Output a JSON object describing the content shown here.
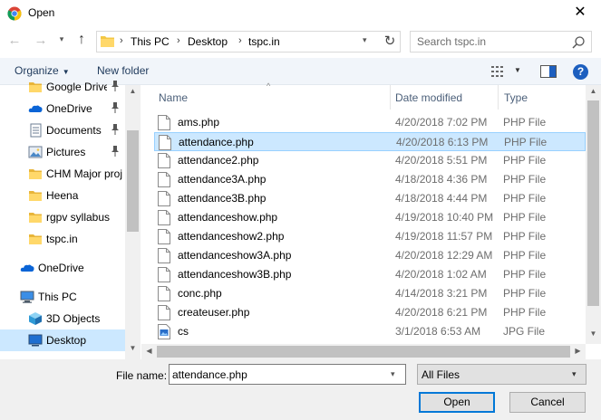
{
  "window": {
    "title": "Open",
    "close_glyph": "✕",
    "icon": "chrome-icon"
  },
  "navigation": {
    "back_glyph": "←",
    "forward_glyph": "→",
    "recent_glyph": "▾",
    "up_glyph": "↑",
    "breadcrumbs": [
      "This PC",
      "Desktop",
      "tspc.in"
    ],
    "separator": "›",
    "refresh_glyph": "↻",
    "search_placeholder": "Search tspc.in"
  },
  "toolbar": {
    "organize_label": "Organize",
    "organize_arrow": "▼",
    "new_folder_label": "New folder",
    "view_dropdown_glyph": "▼",
    "help_label": "?"
  },
  "sidebar": {
    "items": [
      {
        "label": "Google Drive",
        "icon": "folder-icon",
        "pinned": true
      },
      {
        "label": "OneDrive",
        "icon": "onedrive-icon",
        "pinned": true
      },
      {
        "label": "Documents",
        "icon": "documents-icon",
        "pinned": true
      },
      {
        "label": "Pictures",
        "icon": "pictures-icon",
        "pinned": true
      },
      {
        "label": "CHM Major proj",
        "icon": "folder-icon",
        "pinned": false
      },
      {
        "label": "Heena",
        "icon": "folder-icon",
        "pinned": false
      },
      {
        "label": "rgpv syllabus",
        "icon": "folder-icon",
        "pinned": false
      },
      {
        "label": "tspc.in",
        "icon": "folder-icon",
        "pinned": false
      },
      {
        "label": "OneDrive",
        "icon": "onedrive-icon",
        "pinned": false
      },
      {
        "label": "This PC",
        "icon": "computer-icon",
        "pinned": false
      },
      {
        "label": "3D Objects",
        "icon": "3d-objects-icon",
        "pinned": false
      },
      {
        "label": "Desktop",
        "icon": "desktop-icon",
        "pinned": false
      }
    ],
    "pin_glyph": "📌",
    "selected_item": "Desktop"
  },
  "file_list": {
    "columns": [
      "Name",
      "Date modified",
      "Type"
    ],
    "sort_glyph": "^",
    "rows": [
      {
        "name": "ams.php",
        "date": "4/20/2018 7:02 PM",
        "type": "PHP File"
      },
      {
        "name": "attendance.php",
        "date": "4/20/2018 6:13 PM",
        "type": "PHP File"
      },
      {
        "name": "attendance2.php",
        "date": "4/20/2018 5:51 PM",
        "type": "PHP File"
      },
      {
        "name": "attendance3A.php",
        "date": "4/18/2018 4:36 PM",
        "type": "PHP File"
      },
      {
        "name": "attendance3B.php",
        "date": "4/18/2018 4:44 PM",
        "type": "PHP File"
      },
      {
        "name": "attendanceshow.php",
        "date": "4/19/2018 10:40 PM",
        "type": "PHP File"
      },
      {
        "name": "attendanceshow2.php",
        "date": "4/19/2018 11:57 PM",
        "type": "PHP File"
      },
      {
        "name": "attendanceshow3A.php",
        "date": "4/20/2018 12:29 AM",
        "type": "PHP File"
      },
      {
        "name": "attendanceshow3B.php",
        "date": "4/20/2018 1:02 AM",
        "type": "PHP File"
      },
      {
        "name": "conc.php",
        "date": "4/14/2018 3:21 PM",
        "type": "PHP File"
      },
      {
        "name": "createuser.php",
        "date": "4/20/2018 6:21 PM",
        "type": "PHP File"
      },
      {
        "name": "cs",
        "date": "3/1/2018 6:53 AM",
        "type": "JPG File"
      }
    ],
    "selected_row": "attendance.php"
  },
  "scroll_glyphs": {
    "up": "▲",
    "down": "▼",
    "left": "◀",
    "right": "▶"
  },
  "bottom": {
    "file_name_label": "File name:",
    "file_name_value": "attendance.php",
    "file_name_dd": "▾",
    "filter_value": "All Files",
    "filter_dd": "▾",
    "open_label": "Open",
    "cancel_label": "Cancel"
  },
  "colors": {
    "selection": "#cce8ff",
    "toolbar_bg": "#f1f5fa",
    "folder": "#f3c744",
    "accent": "#0078d7"
  }
}
